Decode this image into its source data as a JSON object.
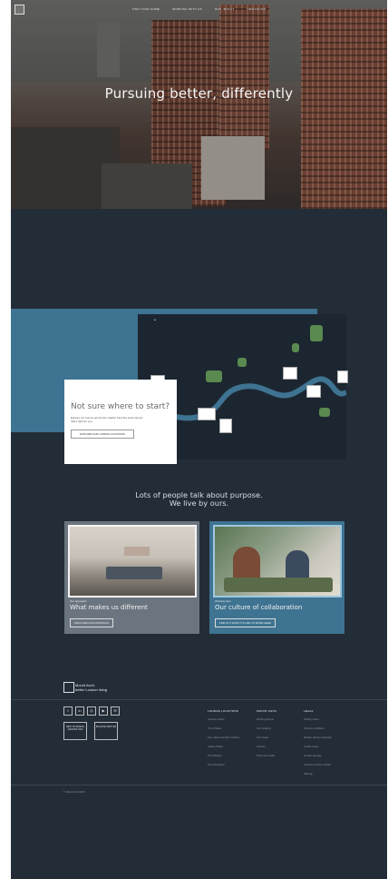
{
  "header": {
    "nav": [
      "FIND YOUR HOME",
      "WORKING WITH US",
      "OUR IMPACT",
      "NEWSROOM"
    ]
  },
  "hero": {
    "title": "Pursuing better, differently"
  },
  "map_section": {
    "card_title": "Not sure where to start?",
    "card_text": "Explore our homes across the capital. Find the environment that's right for you.",
    "card_button": "EXPLORE OUR LONDON LOCATIONS"
  },
  "purpose": {
    "line1": "Lots of people talk about purpose.",
    "line2": "We live by ours."
  },
  "features": [
    {
      "label": "Our approach",
      "title": "What makes us different",
      "button": "DISCOVER OUR APPROACH",
      "color": "#6b7580"
    },
    {
      "label": "Working here",
      "title": "Our culture of collaboration",
      "button": "FIND OUT WHAT IT'S LIKE TO WORK HERE",
      "color": "#3e7391"
    }
  ],
  "footer": {
    "brand_line1": "Mount Anvil,",
    "brand_line2": "better London living",
    "social_icons": [
      "twitter-icon",
      "linkedin-icon",
      "instagram-icon",
      "youtube-icon",
      "wechat-icon"
    ],
    "badges": [
      "BEST BUSINESS AWARDS 2023",
      "BUILDING BETTER"
    ],
    "columns": [
      {
        "heading": "LONDON LOCATIONS",
        "items": [
          "Central London",
          "The Chelsea",
          "Kew, Hammersmith & Fulham",
          "Canary Wharf",
          "The Islington",
          "The Kensington"
        ]
      },
      {
        "heading": "MOUNT ANVIL",
        "items": [
          "Working with us",
          "Our Academy",
          "Our impact",
          "Careers",
          "Press and media"
        ]
      },
      {
        "heading": "LEGAL",
        "items": [
          "Privacy notice",
          "Terms & conditions",
          "Modern slavery statement",
          "Cookie notice",
          "Gender pay gap",
          "Customer service charter",
          "Sitemap"
        ]
      }
    ],
    "copyright": "© Mount Anvil 2023"
  },
  "colors": {
    "background": "#232d38",
    "accent": "#3e7391",
    "grey_card": "#6b7580"
  }
}
